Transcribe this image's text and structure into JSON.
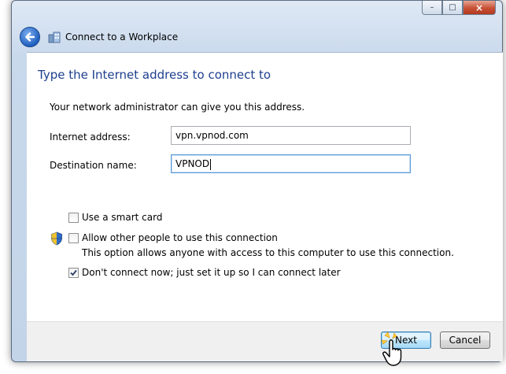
{
  "window": {
    "title": "Connect to a Workplace",
    "caption_buttons": {
      "minimize": "–",
      "maximize": "□",
      "close": "×"
    }
  },
  "page": {
    "heading": "Type the Internet address to connect to",
    "description": "Your network administrator can give you this address."
  },
  "form": {
    "internet_address_label": "Internet address:",
    "internet_address_value": "vpn.vpnod.com",
    "destination_name_label": "Destination name:",
    "destination_name_value": "VPNOD"
  },
  "options": {
    "smart_card": {
      "label": "Use a smart card",
      "checked": false
    },
    "allow_others": {
      "label": "Allow other people to use this connection",
      "help": "This option allows anyone with access to this computer to use this connection.",
      "checked": false
    },
    "dont_connect": {
      "label": "Don't connect now; just set it up so I can connect later",
      "checked": true
    }
  },
  "buttons": {
    "next": "Next",
    "cancel": "Cancel"
  },
  "colors": {
    "heading": "#1e3f8f",
    "accent": "#3c7fb1"
  }
}
